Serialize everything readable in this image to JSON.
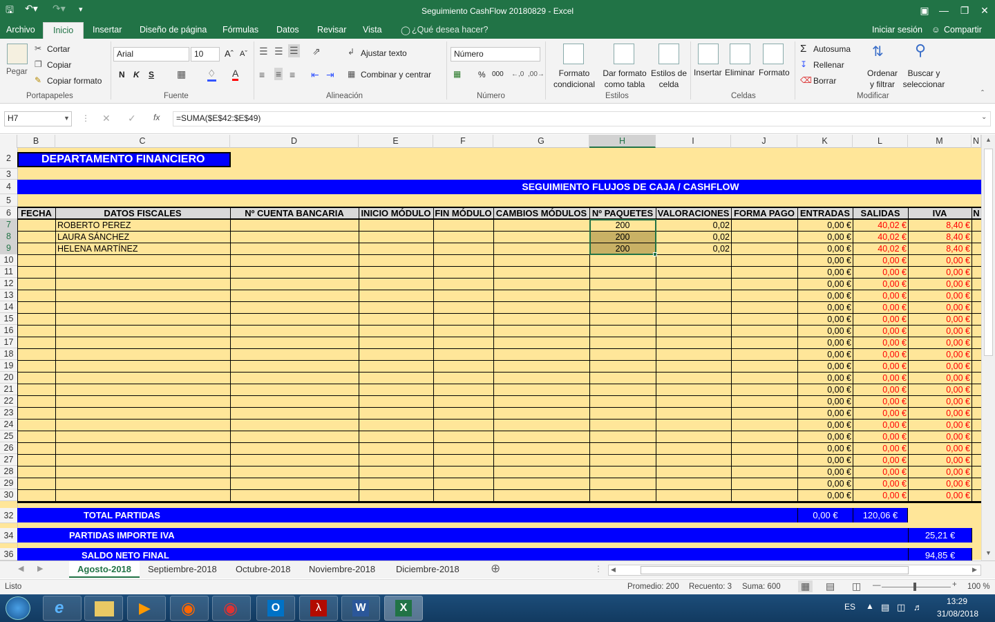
{
  "window": {
    "title": "Seguimiento CashFlow 20180829 - Excel"
  },
  "ribbon_tabs": [
    "Archivo",
    "Inicio",
    "Insertar",
    "Diseño de página",
    "Fórmulas",
    "Datos",
    "Revisar",
    "Vista"
  ],
  "tell_me": "¿Qué desea hacer?",
  "account": {
    "signin": "Iniciar sesión",
    "share": "Compartir"
  },
  "clipboard": {
    "paste": "Pegar",
    "cut": "Cortar",
    "copy": "Copiar",
    "format_painter": "Copiar formato",
    "group": "Portapapeles"
  },
  "font": {
    "name": "Arial",
    "size": "10",
    "group": "Fuente",
    "bold": "N",
    "italic": "K",
    "underline": "S"
  },
  "alignment": {
    "wrap": "Ajustar texto",
    "merge": "Combinar y centrar",
    "group": "Alineación"
  },
  "number": {
    "format": "Número",
    "group": "Número",
    "percent": "%",
    "thousands": "000"
  },
  "styles": {
    "conditional": "Formato condicional",
    "table": "Dar formato como tabla",
    "cell": "Estilos de celda",
    "group": "Estilos"
  },
  "cells": {
    "insert": "Insertar",
    "delete": "Eliminar",
    "format": "Formato",
    "group": "Celdas"
  },
  "editing": {
    "autosum": "Autosuma",
    "fill": "Rellenar",
    "clear": "Borrar",
    "sort": "Ordenar y filtrar",
    "find": "Buscar y seleccionar",
    "group": "Modificar"
  },
  "formula_bar": {
    "namebox": "H7",
    "fx": "fx",
    "formula": "=SUMA($E$42:$E$49)"
  },
  "columns": [
    "B",
    "C",
    "D",
    "E",
    "F",
    "G",
    "H",
    "I",
    "J",
    "K",
    "L",
    "M",
    "N"
  ],
  "rows": [
    "2",
    "3",
    "4",
    "5",
    "6",
    "7",
    "8",
    "9",
    "10",
    "11",
    "12",
    "13",
    "14",
    "15",
    "16",
    "17",
    "18",
    "19",
    "20",
    "21",
    "22",
    "23",
    "24",
    "25",
    "26",
    "27",
    "28",
    "29",
    "30",
    "32",
    "34",
    "36"
  ],
  "sheet": {
    "dept_title": "DEPARTAMENTO FINANCIERO",
    "main_title": "SEGUIMIENTO FLUJOS DE CAJA / CASHFLOW",
    "headers": [
      "FECHA",
      "DATOS FISCALES",
      "Nº CUENTA BANCARIA",
      "INICIO MÓDULO",
      "FIN MÓDULO",
      "CAMBIOS MÓDULOS",
      "Nº PAQUETES",
      "VALORACIONES",
      "FORMA PAGO",
      "ENTRADAS",
      "SALIDAS",
      "IVA",
      "N"
    ],
    "data_rows": [
      {
        "name": "ROBERTO PEREZ",
        "paquetes": "200",
        "valor": "0,02",
        "entradas": "0,00 €",
        "salidas": "40,02 €",
        "iva": "8,40 €"
      },
      {
        "name": "LAURA SÁNCHEZ",
        "paquetes": "200",
        "valor": "0,02",
        "entradas": "0,00 €",
        "salidas": "40,02 €",
        "iva": "8,40 €"
      },
      {
        "name": "HELENA MARTÍNEZ",
        "paquetes": "200",
        "valor": "0,02",
        "entradas": "0,00 €",
        "salidas": "40,02 €",
        "iva": "8,40 €"
      }
    ],
    "zero": "0,00 €",
    "total_label": "TOTAL PARTIDAS",
    "total_entradas": "0,00 €",
    "total_salidas": "120,06 €",
    "iva_label": "PARTIDAS IMPORTE IVA",
    "iva_total": "25,21 €",
    "neto_label": "SALDO NETO FINAL",
    "neto_total": "94,85 €"
  },
  "sheet_tabs": [
    "Agosto-2018",
    "Septiembre-2018",
    "Octubre-2018",
    "Noviembre-2018",
    "Diciembre-2018"
  ],
  "status": {
    "ready": "Listo",
    "average": "Promedio: 200",
    "count": "Recuento: 3",
    "sum": "Suma: 600",
    "zoom": "100 %"
  },
  "taskbar": {
    "lang": "ES",
    "time": "13:29",
    "date": "31/08/2018"
  },
  "colors": {
    "excel_green": "#217346",
    "cell_fill": "#ffe699",
    "header_blue": "#0000ff",
    "negative_red": "#ff0000"
  }
}
